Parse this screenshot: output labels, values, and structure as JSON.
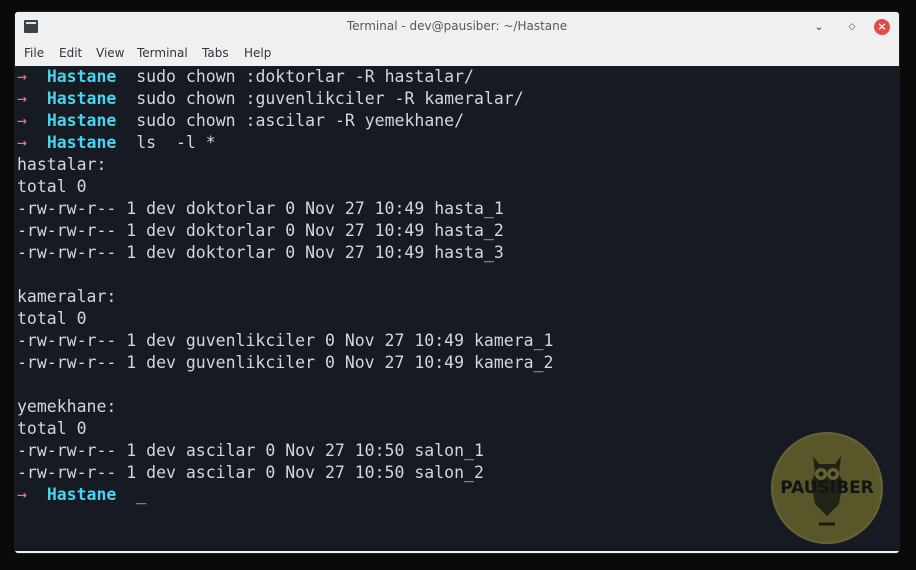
{
  "window": {
    "title": "Terminal - dev@pausiber: ~/Hastane"
  },
  "menu": [
    "File",
    "Edit",
    "View",
    "Terminal",
    "Tabs",
    "Help"
  ],
  "prompt": {
    "arrow": "→",
    "dir": "Hastane"
  },
  "commands": [
    "sudo chown :doktorlar -R hastalar/",
    "sudo chown :guvenlikciler -R kameralar/",
    "sudo chown :ascilar -R yemekhane/",
    "ls  -l *"
  ],
  "output": [
    "hastalar:",
    "total 0",
    "-rw-rw-r-- 1 dev doktorlar 0 Nov 27 10:49 hasta_1",
    "-rw-rw-r-- 1 dev doktorlar 0 Nov 27 10:49 hasta_2",
    "-rw-rw-r-- 1 dev doktorlar 0 Nov 27 10:49 hasta_3",
    "",
    "kameralar:",
    "total 0",
    "-rw-rw-r-- 1 dev guvenlikciler 0 Nov 27 10:49 kamera_1",
    "-rw-rw-r-- 1 dev guvenlikciler 0 Nov 27 10:49 kamera_2",
    "",
    "yemekhane:",
    "total 0",
    "-rw-rw-r-- 1 dev ascilar 0 Nov 27 10:50 salon_1",
    "-rw-rw-r-- 1 dev ascilar 0 Nov 27 10:50 salon_2"
  ],
  "cursor": "_",
  "logo": {
    "text": "PAUSIBER"
  },
  "icons": {
    "app": "terminal-icon",
    "minimize": "minimize-icon",
    "maximize": "maximize-icon",
    "close": "close-icon"
  },
  "colors": {
    "terminal_bg": "#161a22",
    "prompt_arrow": "#ff6e6e",
    "prompt_dir": "#4ad3ee",
    "close_button": "#e34a4a"
  }
}
